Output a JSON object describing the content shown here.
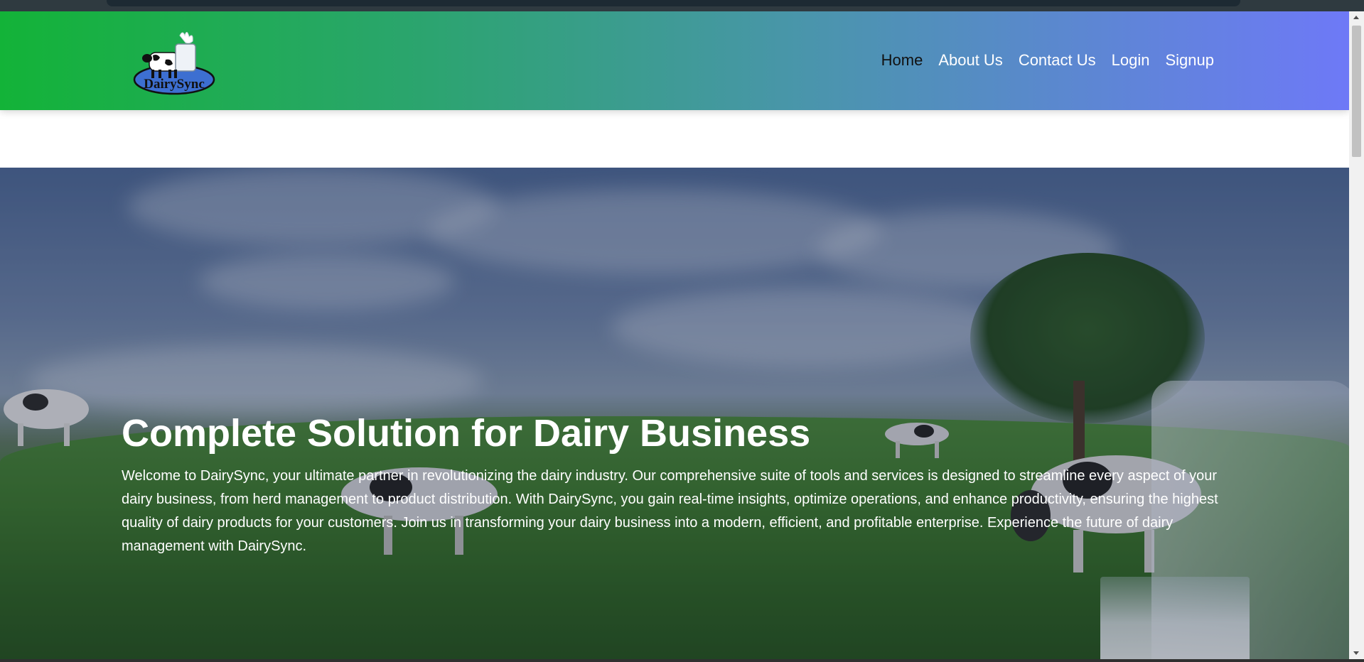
{
  "logo": {
    "text": "DairySync",
    "icon": "cow-milk-logo-icon"
  },
  "nav": {
    "items": [
      {
        "label": "Home",
        "active": true
      },
      {
        "label": "About Us",
        "active": false
      },
      {
        "label": "Contact Us",
        "active": false
      },
      {
        "label": "Login",
        "active": false
      },
      {
        "label": "Signup",
        "active": false
      }
    ]
  },
  "hero": {
    "title": "Complete Solution for Dairy Business",
    "text": "Welcome to DairySync, your ultimate partner in revolutionizing the dairy industry. Our comprehensive suite of tools and services is designed to streamline every aspect of your dairy business, from herd management to product distribution. With DairySync, you gain real-time insights, optimize operations, and enhance productivity, ensuring the highest quality of dairy products for your customers. Join us in transforming your dairy business into a modern, efficient, and profitable enterprise. Experience the future of dairy management with DairySync."
  },
  "colors": {
    "nav_gradient_start": "#13b338",
    "nav_gradient_end": "#6e79f7",
    "nav_active": "#111111",
    "nav_text": "#ffffff"
  }
}
